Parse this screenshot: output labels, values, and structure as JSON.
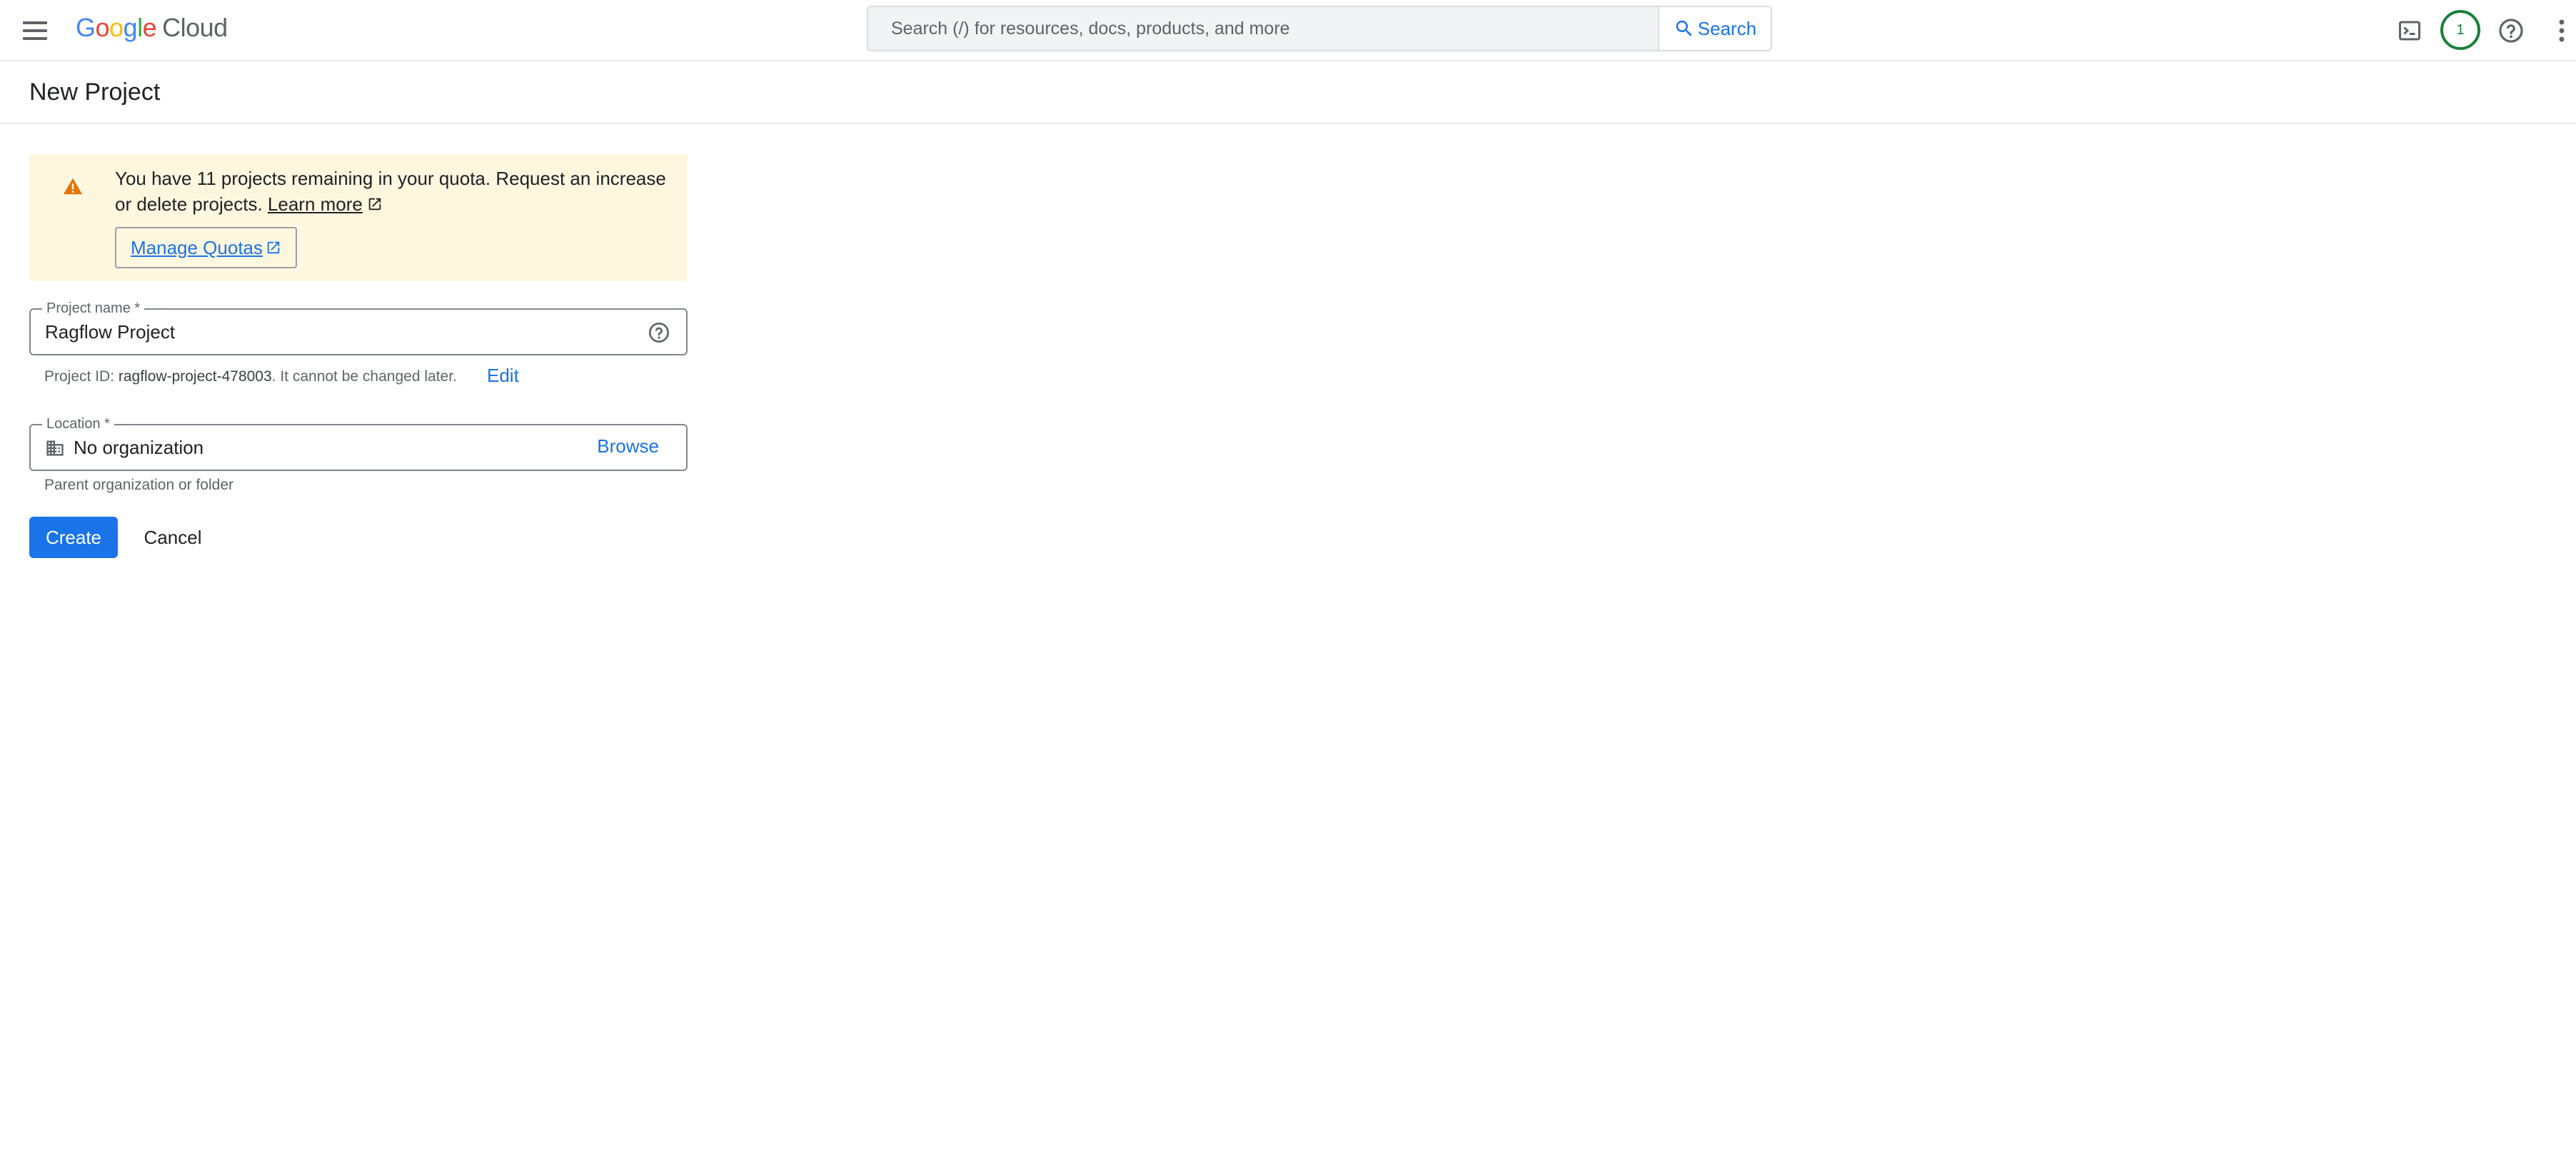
{
  "header": {
    "logo_letters": [
      "G",
      "o",
      "o",
      "g",
      "l",
      "e"
    ],
    "logo_suffix": "Cloud",
    "search_placeholder": "Search (/) for resources, docs, products, and more",
    "search_button_label": "Search",
    "avatar_badge": "1"
  },
  "page": {
    "title": "New Project"
  },
  "banner": {
    "message": "You have 11 projects remaining in your quota. Request an increase or delete projects.",
    "learn_more_label": "Learn more",
    "manage_quotas_label": "Manage Quotas"
  },
  "form": {
    "project_name": {
      "label": "Project name *",
      "value": "Ragflow Project"
    },
    "project_id_hint": {
      "prefix": "Project ID: ",
      "id": "ragflow-project-478003",
      "suffix": ". It cannot be changed later.",
      "edit_label": "Edit"
    },
    "location": {
      "label": "Location *",
      "value": "No organization",
      "browse_label": "Browse",
      "hint": "Parent organization or folder"
    }
  },
  "actions": {
    "create_label": "Create",
    "cancel_label": "Cancel"
  },
  "colors": {
    "accent": "#1a73e8",
    "banner_bg": "#fef7e0",
    "warning": "#e37400",
    "avatar_ring": "#188038"
  },
  "icons": [
    "menu-icon",
    "search-icon",
    "terminal-icon",
    "help-icon",
    "more-vert-icon",
    "warning-icon",
    "external-link-icon",
    "help-circle-icon",
    "building-icon"
  ]
}
